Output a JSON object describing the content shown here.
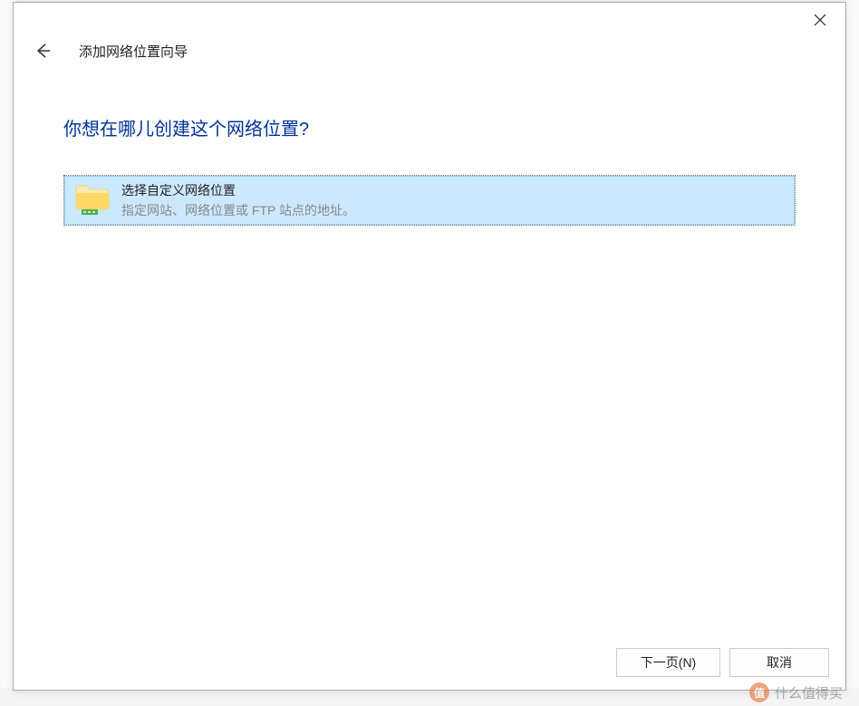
{
  "dialog": {
    "title": "添加网络位置向导",
    "heading": "你想在哪儿创建这个网络位置?",
    "option": {
      "title": "选择自定义网络位置",
      "description": "指定网站、网络位置或 FTP 站点的地址。"
    },
    "buttons": {
      "next": "下一页(N)",
      "cancel": "取消"
    }
  },
  "watermark": {
    "text": "什么值得买"
  }
}
